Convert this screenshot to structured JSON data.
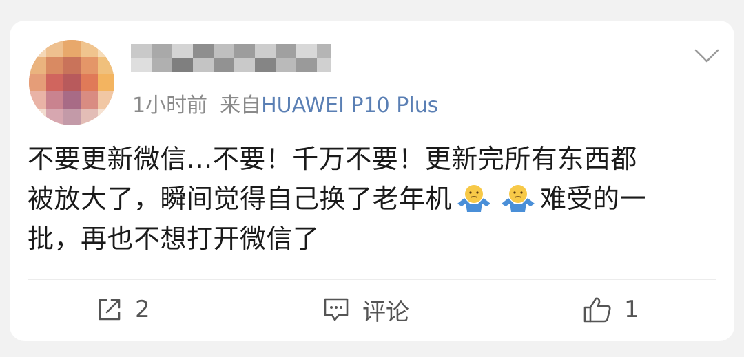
{
  "post": {
    "username": "",
    "time": "1小时前",
    "source_prefix": "来自",
    "device": "HUAWEI P10 Plus",
    "content_line1": "不要更新微信...不要！千万不要！更新完所有东西都",
    "content_line2a": "被放大了，瞬间觉得自己换了老年机",
    "content_line2b": "难受的一",
    "content_line3": "批，再也不想打开微信了"
  },
  "actions": {
    "repost_count": "2",
    "comment_label": "评论",
    "like_count": "1"
  },
  "icons": {
    "menu": "chevron-down-icon",
    "repost": "share-icon",
    "comment": "comment-icon",
    "like": "thumbs-up-icon",
    "emoji": "shrug-emoji"
  },
  "colors": {
    "meta": "#8a8a8a",
    "device": "#5a7fb4",
    "text": "#1a1a1a",
    "emoji_face": "#f7c948",
    "emoji_body": "#4a8fd8"
  }
}
